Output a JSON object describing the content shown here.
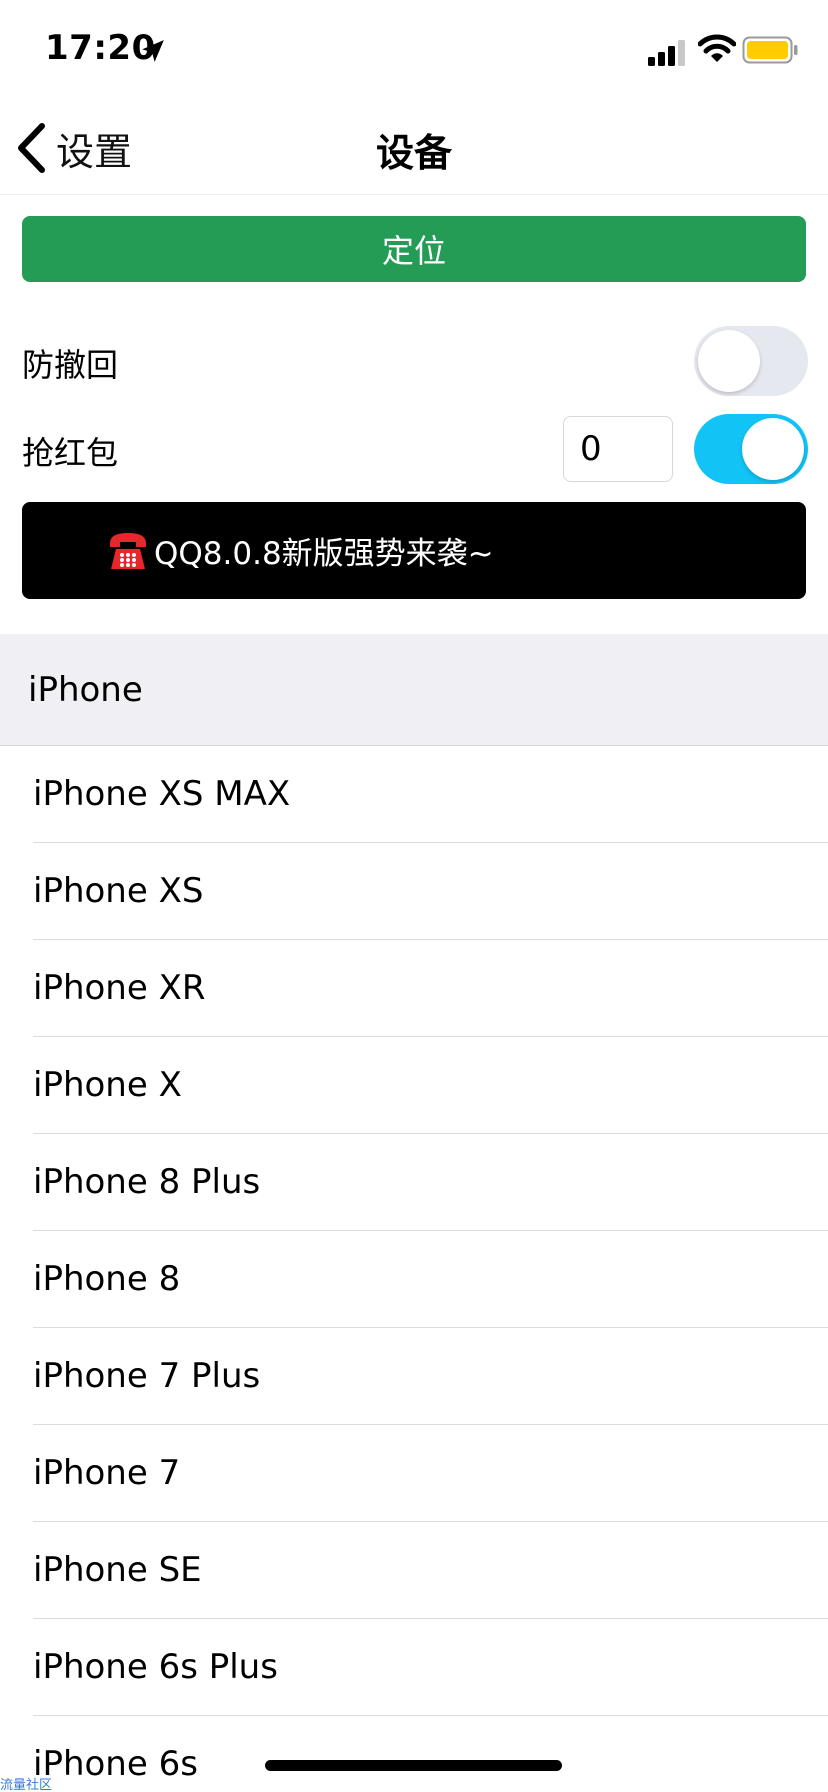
{
  "status_bar": {
    "time": "17:20"
  },
  "nav": {
    "back_label": "设置",
    "title": "设备"
  },
  "locate_button": {
    "label": "定位"
  },
  "anti_recall": {
    "label": "防撤回",
    "enabled": false
  },
  "red_packet": {
    "label": "抢红包",
    "count_value": "0",
    "enabled": true
  },
  "banner": {
    "text": "QQ8.0.8新版强势来袭~"
  },
  "section": {
    "title": "iPhone"
  },
  "devices": [
    "iPhone XS MAX",
    "iPhone XS",
    "iPhone XR",
    "iPhone X",
    "iPhone 8 Plus",
    "iPhone 8",
    "iPhone 7 Plus",
    "iPhone 7",
    "iPhone SE",
    "iPhone 6s Plus",
    "iPhone 6s"
  ],
  "watermark": "流量社区",
  "colors": {
    "locate_green": "#249c55",
    "toggle_on": "#12c4f5",
    "battery": "#ffcc00"
  }
}
